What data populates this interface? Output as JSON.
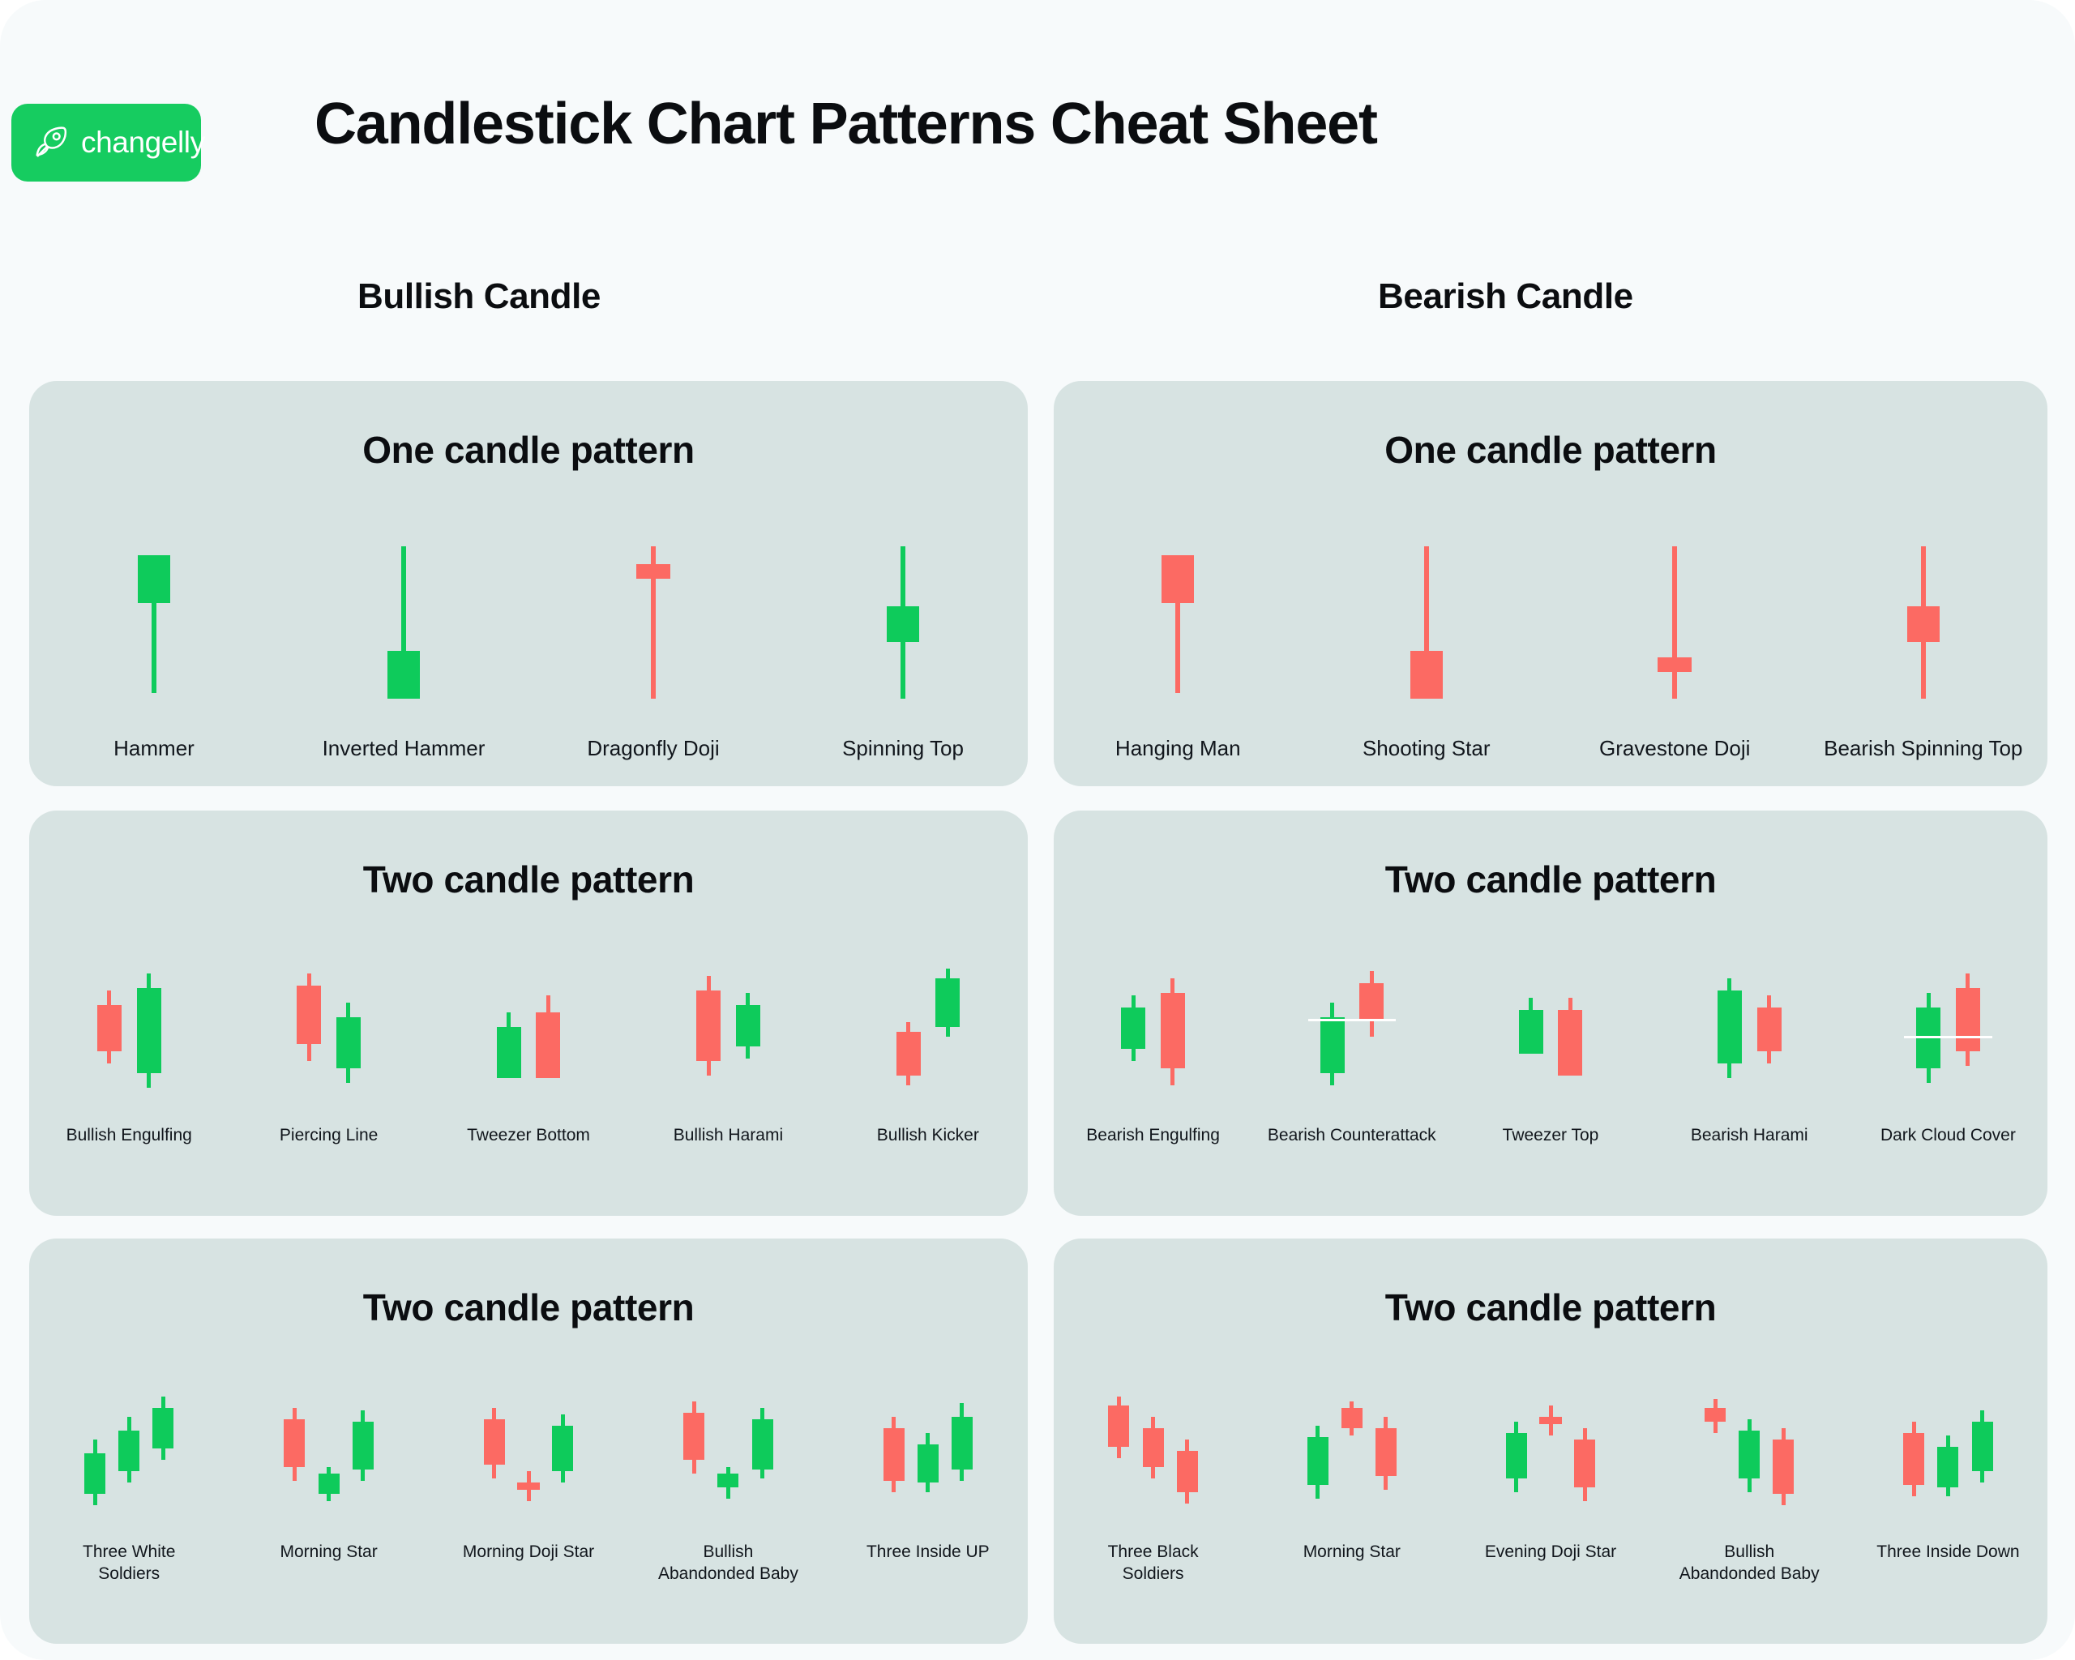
{
  "brand": {
    "name": "changelly",
    "icon": "rocket-icon",
    "badge_color": "#16cc60"
  },
  "title": "Candlestick Chart Patterns Cheat Sheet",
  "columns": {
    "bullish": "Bullish Candle",
    "bearish": "Bearish Candle"
  },
  "colors": {
    "page_bg": "#f7fafb",
    "panel_bg": "#d7e3e2",
    "bull": "#0ecb5b",
    "bear": "#fc6a63",
    "text": "#0b0d10",
    "connector": "#ffffff"
  },
  "chart_data": {
    "type": "candlestick-reference",
    "title": "Candlestick Chart Patterns Cheat Sheet",
    "panels": [
      {
        "id": "bullish-one",
        "side": "bullish",
        "title": "One candle pattern",
        "patterns": [
          {
            "label": "Hammer",
            "candles": [
              {
                "color": "bull",
                "bodyTop": 8,
                "bodyBottom": 40,
                "wickTop": 8,
                "wickBottom": 100
              }
            ]
          },
          {
            "label": "Inverted Hammer",
            "candles": [
              {
                "color": "bull",
                "bodyTop": 72,
                "bodyBottom": 104,
                "wickTop": 2,
                "wickBottom": 104
              }
            ]
          },
          {
            "label": "Dragonfly Doji",
            "candles": [
              {
                "color": "bear",
                "bodyTop": 14,
                "bodyBottom": 24,
                "wickTop": 2,
                "wickBottom": 104,
                "wide": true
              }
            ]
          },
          {
            "label": "Spinning Top",
            "candles": [
              {
                "color": "bull",
                "bodyTop": 42,
                "bodyBottom": 66,
                "wickTop": 2,
                "wickBottom": 104
              }
            ]
          }
        ]
      },
      {
        "id": "bearish-one",
        "side": "bearish",
        "title": "One candle pattern",
        "patterns": [
          {
            "label": "Hanging Man",
            "candles": [
              {
                "color": "bear",
                "bodyTop": 8,
                "bodyBottom": 40,
                "wickTop": 8,
                "wickBottom": 100
              }
            ]
          },
          {
            "label": "Shooting Star",
            "candles": [
              {
                "color": "bear",
                "bodyTop": 72,
                "bodyBottom": 104,
                "wickTop": 2,
                "wickBottom": 104
              }
            ]
          },
          {
            "label": "Gravestone Doji",
            "candles": [
              {
                "color": "bear",
                "bodyTop": 76,
                "bodyBottom": 86,
                "wickTop": 2,
                "wickBottom": 104,
                "wide": true
              }
            ]
          },
          {
            "label": "Bearish Spinning Top",
            "candles": [
              {
                "color": "bear",
                "bodyTop": 42,
                "bodyBottom": 66,
                "wickTop": 2,
                "wickBottom": 104
              }
            ]
          }
        ]
      },
      {
        "id": "bullish-two",
        "side": "bullish",
        "title": "Two candle pattern",
        "patterns": [
          {
            "label": "Bullish Engulfing",
            "candles": [
              {
                "color": "bear",
                "x": 0,
                "bodyTop": 30,
                "bodyBottom": 68,
                "wickTop": 18,
                "wickBottom": 78
              },
              {
                "color": "bull",
                "x": 34,
                "bodyTop": 16,
                "bodyBottom": 86,
                "wickTop": 4,
                "wickBottom": 98
              }
            ]
          },
          {
            "label": "Piercing Line",
            "candles": [
              {
                "color": "bear",
                "x": 0,
                "bodyTop": 14,
                "bodyBottom": 62,
                "wickTop": 4,
                "wickBottom": 76
              },
              {
                "color": "bull",
                "x": 34,
                "bodyTop": 40,
                "bodyBottom": 82,
                "wickTop": 28,
                "wickBottom": 94
              }
            ]
          },
          {
            "label": "Tweezer Bottom",
            "candles": [
              {
                "color": "bull",
                "x": 0,
                "bodyTop": 48,
                "bodyBottom": 90,
                "wickTop": 36,
                "wickBottom": 90
              },
              {
                "color": "bear",
                "x": 34,
                "bodyTop": 36,
                "bodyBottom": 90,
                "wickTop": 22,
                "wickBottom": 90
              }
            ]
          },
          {
            "label": "Bullish Harami",
            "candles": [
              {
                "color": "bear",
                "x": 0,
                "bodyTop": 18,
                "bodyBottom": 76,
                "wickTop": 6,
                "wickBottom": 88
              },
              {
                "color": "bull",
                "x": 34,
                "bodyTop": 30,
                "bodyBottom": 64,
                "wickTop": 20,
                "wickBottom": 74
              }
            ]
          },
          {
            "label": "Bullish Kicker",
            "candles": [
              {
                "color": "bear",
                "x": 0,
                "bodyTop": 52,
                "bodyBottom": 88,
                "wickTop": 44,
                "wickBottom": 96
              },
              {
                "color": "bull",
                "x": 34,
                "bodyTop": 8,
                "bodyBottom": 48,
                "wickTop": 0,
                "wickBottom": 56
              }
            ]
          }
        ]
      },
      {
        "id": "bearish-two",
        "side": "bearish",
        "title": "Two candle pattern",
        "patterns": [
          {
            "label": "Bearish Engulfing",
            "candles": [
              {
                "color": "bull",
                "x": 0,
                "bodyTop": 32,
                "bodyBottom": 66,
                "wickTop": 22,
                "wickBottom": 76
              },
              {
                "color": "bear",
                "x": 34,
                "bodyTop": 20,
                "bodyBottom": 82,
                "wickTop": 8,
                "wickBottom": 96
              }
            ]
          },
          {
            "label": "Bearish Counterattack",
            "candles": [
              {
                "color": "bull",
                "x": 0,
                "bodyTop": 40,
                "bodyBottom": 86,
                "wickTop": 28,
                "wickBottom": 96
              },
              {
                "color": "bear",
                "x": 34,
                "bodyTop": 12,
                "bodyBottom": 42,
                "wickTop": 2,
                "wickBottom": 56
              }
            ],
            "connector": 41
          },
          {
            "label": "Tweezer Top",
            "candles": [
              {
                "color": "bull",
                "x": 0,
                "bodyTop": 34,
                "bodyBottom": 70,
                "wickTop": 24,
                "wickBottom": 70
              },
              {
                "color": "bear",
                "x": 34,
                "bodyTop": 34,
                "bodyBottom": 88,
                "wickTop": 24,
                "wickBottom": 88
              }
            ]
          },
          {
            "label": "Bearish Harami",
            "candles": [
              {
                "color": "bull",
                "x": 0,
                "bodyTop": 18,
                "bodyBottom": 78,
                "wickTop": 8,
                "wickBottom": 90
              },
              {
                "color": "bear",
                "x": 34,
                "bodyTop": 32,
                "bodyBottom": 68,
                "wickTop": 22,
                "wickBottom": 78
              }
            ]
          },
          {
            "label": "Dark Cloud Cover",
            "candles": [
              {
                "color": "bull",
                "x": 0,
                "bodyTop": 32,
                "bodyBottom": 82,
                "wickTop": 20,
                "wickBottom": 94
              },
              {
                "color": "bear",
                "x": 34,
                "bodyTop": 16,
                "bodyBottom": 68,
                "wickTop": 4,
                "wickBottom": 80
              }
            ],
            "connector": 55
          }
        ]
      },
      {
        "id": "bullish-three",
        "side": "bullish",
        "title": "Two candle pattern",
        "patterns": [
          {
            "label": "Three White\nSoldiers",
            "candles": [
              {
                "color": "bull",
                "x": 0,
                "bodyTop": 50,
                "bodyBottom": 86,
                "wickTop": 38,
                "wickBottom": 96
              },
              {
                "color": "bull",
                "x": 28,
                "bodyTop": 30,
                "bodyBottom": 66,
                "wickTop": 18,
                "wickBottom": 76
              },
              {
                "color": "bull",
                "x": 56,
                "bodyTop": 10,
                "bodyBottom": 46,
                "wickTop": 0,
                "wickBottom": 56
              }
            ]
          },
          {
            "label": "Morning Star",
            "candles": [
              {
                "color": "bear",
                "x": 0,
                "bodyTop": 20,
                "bodyBottom": 62,
                "wickTop": 10,
                "wickBottom": 74
              },
              {
                "color": "bull",
                "x": 28,
                "bodyTop": 68,
                "bodyBottom": 86,
                "wickTop": 62,
                "wickBottom": 92
              },
              {
                "color": "bull",
                "x": 56,
                "bodyTop": 22,
                "bodyBottom": 64,
                "wickTop": 12,
                "wickBottom": 74
              }
            ]
          },
          {
            "label": "Morning Doji Star",
            "candles": [
              {
                "color": "bear",
                "x": 0,
                "bodyTop": 20,
                "bodyBottom": 60,
                "wickTop": 10,
                "wickBottom": 72
              },
              {
                "color": "bear",
                "x": 28,
                "bodyTop": 76,
                "bodyBottom": 82,
                "wickTop": 66,
                "wickBottom": 92,
                "wide": true
              },
              {
                "color": "bull",
                "x": 56,
                "bodyTop": 26,
                "bodyBottom": 66,
                "wickTop": 16,
                "wickBottom": 76
              }
            ]
          },
          {
            "label": "Bullish\nAbandonded Baby",
            "candles": [
              {
                "color": "bear",
                "x": 0,
                "bodyTop": 14,
                "bodyBottom": 56,
                "wickTop": 4,
                "wickBottom": 68
              },
              {
                "color": "bull",
                "x": 28,
                "bodyTop": 68,
                "bodyBottom": 80,
                "wickTop": 62,
                "wickBottom": 90
              },
              {
                "color": "bull",
                "x": 56,
                "bodyTop": 20,
                "bodyBottom": 64,
                "wickTop": 10,
                "wickBottom": 72
              }
            ]
          },
          {
            "label": "Three Inside UP",
            "candles": [
              {
                "color": "bear",
                "x": 0,
                "bodyTop": 28,
                "bodyBottom": 74,
                "wickTop": 18,
                "wickBottom": 84
              },
              {
                "color": "bull",
                "x": 28,
                "bodyTop": 42,
                "bodyBottom": 76,
                "wickTop": 32,
                "wickBottom": 84
              },
              {
                "color": "bull",
                "x": 56,
                "bodyTop": 18,
                "bodyBottom": 64,
                "wickTop": 6,
                "wickBottom": 74
              }
            ]
          }
        ]
      },
      {
        "id": "bearish-three",
        "side": "bearish",
        "title": "Two candle pattern",
        "patterns": [
          {
            "label": "Three Black\nSoldiers",
            "candles": [
              {
                "color": "bear",
                "x": 0,
                "bodyTop": 8,
                "bodyBottom": 44,
                "wickTop": 0,
                "wickBottom": 54
              },
              {
                "color": "bear",
                "x": 28,
                "bodyTop": 28,
                "bodyBottom": 62,
                "wickTop": 18,
                "wickBottom": 72
              },
              {
                "color": "bear",
                "x": 56,
                "bodyTop": 48,
                "bodyBottom": 84,
                "wickTop": 38,
                "wickBottom": 94
              }
            ]
          },
          {
            "label": "Morning Star",
            "candles": [
              {
                "color": "bull",
                "x": 0,
                "bodyTop": 36,
                "bodyBottom": 78,
                "wickTop": 26,
                "wickBottom": 90
              },
              {
                "color": "bear",
                "x": 28,
                "bodyTop": 10,
                "bodyBottom": 28,
                "wickTop": 4,
                "wickBottom": 34
              },
              {
                "color": "bear",
                "x": 56,
                "bodyTop": 28,
                "bodyBottom": 70,
                "wickTop": 18,
                "wickBottom": 82
              }
            ]
          },
          {
            "label": "Evening Doji Star",
            "candles": [
              {
                "color": "bull",
                "x": 0,
                "bodyTop": 32,
                "bodyBottom": 72,
                "wickTop": 22,
                "wickBottom": 84
              },
              {
                "color": "bear",
                "x": 28,
                "bodyTop": 18,
                "bodyBottom": 24,
                "wickTop": 8,
                "wickBottom": 34,
                "wide": true
              },
              {
                "color": "bear",
                "x": 56,
                "bodyTop": 38,
                "bodyBottom": 80,
                "wickTop": 28,
                "wickBottom": 92
              }
            ]
          },
          {
            "label": "Bullish\nAbandonded Baby",
            "candles": [
              {
                "color": "bear",
                "x": 0,
                "bodyTop": 10,
                "bodyBottom": 22,
                "wickTop": 2,
                "wickBottom": 32
              },
              {
                "color": "bull",
                "x": 28,
                "bodyTop": 30,
                "bodyBottom": 72,
                "wickTop": 20,
                "wickBottom": 84
              },
              {
                "color": "bear",
                "x": 56,
                "bodyTop": 38,
                "bodyBottom": 86,
                "wickTop": 28,
                "wickBottom": 96
              }
            ]
          },
          {
            "label": "Three Inside Down",
            "candles": [
              {
                "color": "bear",
                "x": 0,
                "bodyTop": 32,
                "bodyBottom": 78,
                "wickTop": 22,
                "wickBottom": 88
              },
              {
                "color": "bull",
                "x": 28,
                "bodyTop": 44,
                "bodyBottom": 80,
                "wickTop": 34,
                "wickBottom": 88
              },
              {
                "color": "bull",
                "x": 56,
                "bodyTop": 22,
                "bodyBottom": 66,
                "wickTop": 12,
                "wickBottom": 76
              }
            ]
          }
        ]
      }
    ]
  }
}
